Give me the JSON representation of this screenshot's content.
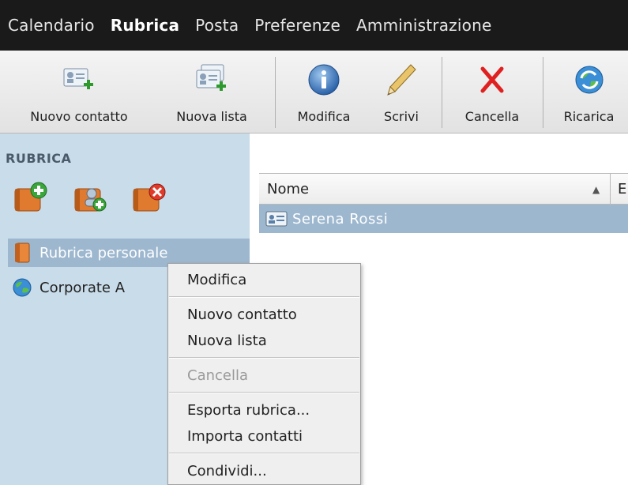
{
  "top_menu": [
    "Calendario",
    "Rubrica",
    "Posta",
    "Preferenze",
    "Amministrazione"
  ],
  "top_menu_active": "Rubrica",
  "toolbar": {
    "new_contact": "Nuovo contatto",
    "new_list": "Nuova lista",
    "edit": "Modifica",
    "write": "Scrivi",
    "delete": "Cancella",
    "reload": "Ricarica"
  },
  "sidebar": {
    "title": "RUBRICA",
    "items": [
      {
        "label": "Rubrica personale",
        "icon": "book-icon"
      },
      {
        "label": "Corporate A",
        "icon": "globe-icon"
      }
    ]
  },
  "grid": {
    "col_name": "Nome",
    "col_email": "E",
    "rows": [
      {
        "name": "Serena Rossi"
      }
    ]
  },
  "context_menu": {
    "edit": "Modifica",
    "new_contact": "Nuovo contatto",
    "new_list": "Nuova lista",
    "delete": "Cancella",
    "export": "Esporta rubrica...",
    "import": "Importa contatti",
    "share": "Condividi..."
  },
  "colors": {
    "menubar": "#1a1a1a",
    "sidebar": "#c9dcea",
    "selection": "#9db7cf",
    "delete_red": "#e02020"
  }
}
